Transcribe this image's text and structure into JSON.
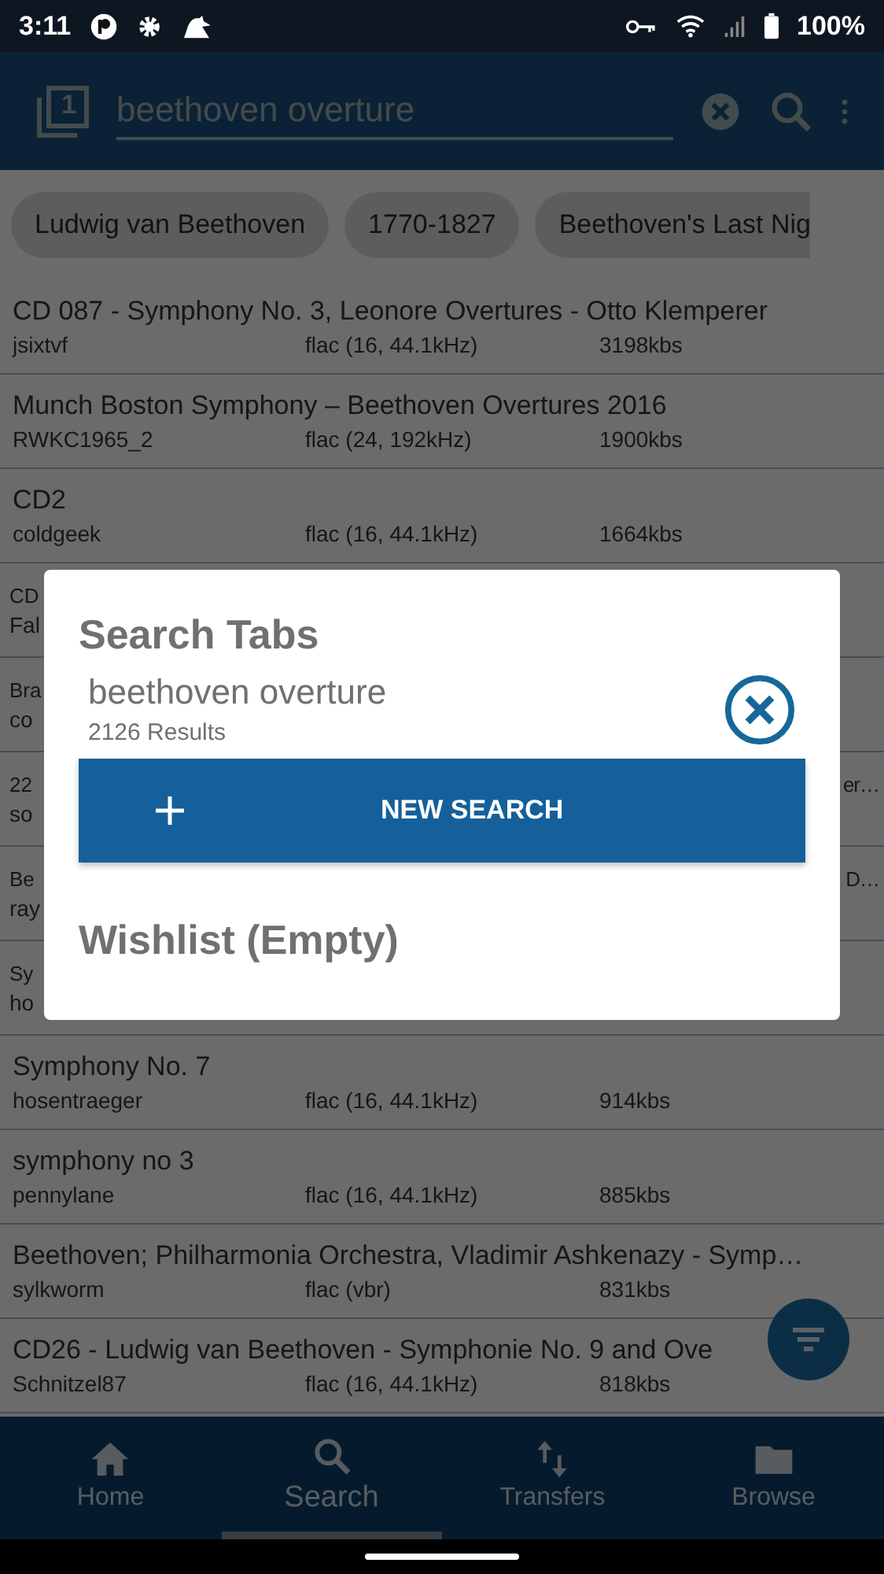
{
  "status_bar": {
    "time": "3:11",
    "battery": "100%"
  },
  "app_bar": {
    "tab_count": "1",
    "search": {
      "value": "beethoven overture"
    }
  },
  "chips": [
    {
      "label": "Ludwig van Beethoven"
    },
    {
      "label": "1770-1827"
    },
    {
      "label": "Beethoven's Last Nig"
    }
  ],
  "results": [
    {
      "kind": "full",
      "title": "CD 087 - Symphony No. 3, Leonore Overtures - Otto Klemperer",
      "user": "jsixtvf",
      "format": "flac (16, 44.1kHz)",
      "bitrate": "3198kbs"
    },
    {
      "kind": "full",
      "title": "Munch Boston Symphony – Beethoven Overtures 2016",
      "user": "RWKC1965_2",
      "format": "flac (24, 192kHz)",
      "bitrate": "1900kbs"
    },
    {
      "kind": "full",
      "title": "CD2",
      "user": "coldgeek",
      "format": "flac (16, 44.1kHz)",
      "bitrate": "1664kbs"
    },
    {
      "kind": "partial",
      "title": "CD",
      "user": "Fal"
    },
    {
      "kind": "partial",
      "title": "Bra",
      "user": "co"
    },
    {
      "kind": "partial",
      "title": "22",
      "title_end": "er…",
      "user": "so"
    },
    {
      "kind": "partial",
      "title": "Be",
      "title_end": "D…",
      "user": "ray"
    },
    {
      "kind": "partial",
      "title": "Sy",
      "user": "ho"
    },
    {
      "kind": "full",
      "title": "Symphony No. 7",
      "user": "hosentraeger",
      "format": "flac (16, 44.1kHz)",
      "bitrate": "914kbs"
    },
    {
      "kind": "full",
      "title": "symphony no 3",
      "user": "pennylane",
      "format": "flac (16, 44.1kHz)",
      "bitrate": "885kbs"
    },
    {
      "kind": "full",
      "title": "Beethoven; Philharmonia Orchestra, Vladimir Ashkenazy - Symp…",
      "user": "sylkworm",
      "format": "flac (vbr)",
      "bitrate": "831kbs"
    },
    {
      "kind": "full",
      "title": "CD26 - Ludwig van Beethoven - Symphonie No. 9 and Ove",
      "user": "Schnitzel87",
      "format": "flac (16, 44.1kHz)",
      "bitrate": "818kbs"
    }
  ],
  "bottom_nav": [
    {
      "label": "Home",
      "selected": false
    },
    {
      "label": "Search",
      "selected": true
    },
    {
      "label": "Transfers",
      "selected": false
    },
    {
      "label": "Browse",
      "selected": false
    }
  ],
  "dialog": {
    "title": "Search Tabs",
    "tabs": [
      {
        "query": "beethoven overture",
        "count": "2126 Results"
      }
    ],
    "new_search_label": "NEW SEARCH",
    "wishlist_title": "Wishlist (Empty)"
  }
}
